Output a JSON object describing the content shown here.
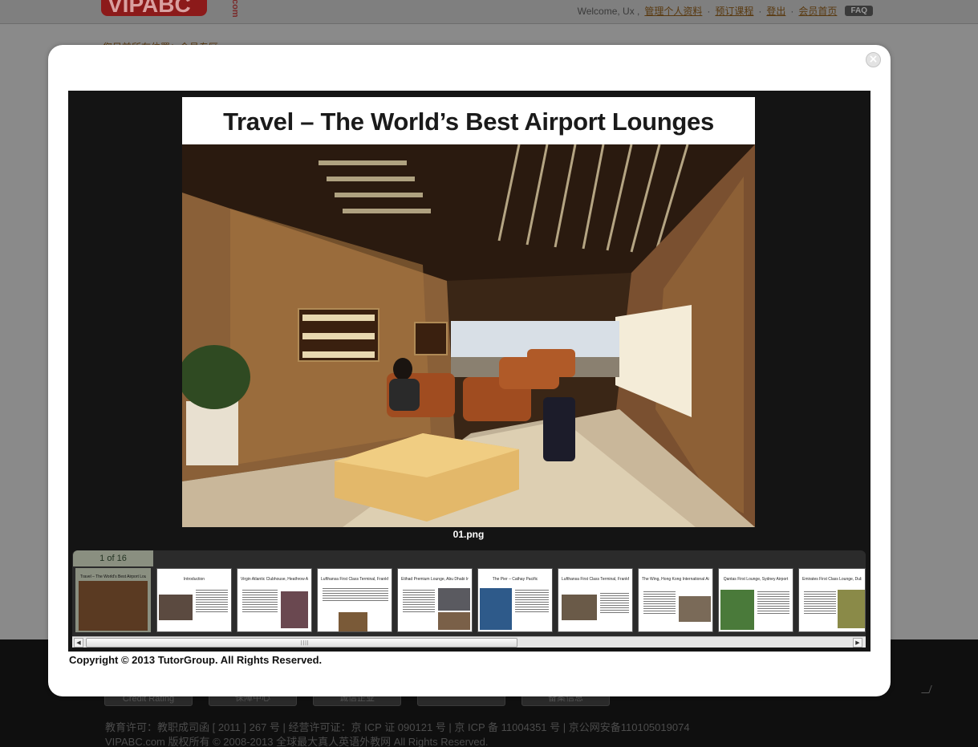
{
  "header": {
    "logo_text": "VIPABC",
    "logo_suffix": ".com",
    "welcome": "Welcome, Ux ,",
    "links": [
      "管理个人资料",
      "预订课程",
      "登出",
      "会员首页"
    ],
    "faq": "FAQ",
    "breadcrumb": "您目前所在位置：会员专区 >"
  },
  "modal": {
    "close_icon": "close-icon",
    "slide": {
      "title": "Travel – The World’s Best Airport Lounges",
      "filename": "01.png"
    },
    "thumbnail_strip": {
      "counter": "1 of 16",
      "thumbs": [
        {
          "caption": "Travel – The World's Best Airport Lounges"
        },
        {
          "caption": "Introduction"
        },
        {
          "caption": "Virgin Atlantic Clubhouse, Heathrow Airport, London"
        },
        {
          "caption": "Lufthansa First Class Terminal, Frankfurt"
        },
        {
          "caption": "Etihad Premium Lounge, Abu Dhabi International Airport"
        },
        {
          "caption": "The Pier – Cathay Pacific"
        },
        {
          "caption": "Lufthansa First Class Terminal, Frankfurt Airport"
        },
        {
          "caption": "The Wing, Hong Kong International Airport"
        },
        {
          "caption": "Qantas First Lounge, Sydney Airport"
        },
        {
          "caption": "Emirates First Class Lounge, Dubai International Airport"
        }
      ]
    },
    "copyright": "Copyright © 2013 TutorGroup. All Rights Reserved."
  },
  "footer": {
    "badges": [
      "Credit Rating",
      "保障中心",
      "诚信企业",
      "",
      "备案信息"
    ],
    "license_line": "教育许可：教职成司函 [ 2011 ] 267 号 | 经营许可证：京 ICP 证 090121 号 | 京 ICP 备 11004351 号 | 京公网安备110105019074",
    "rights_line": "VIPABC.com 版权所有 © 2008-2013 全球最大真人英语外教网 All Rights Reserved."
  }
}
